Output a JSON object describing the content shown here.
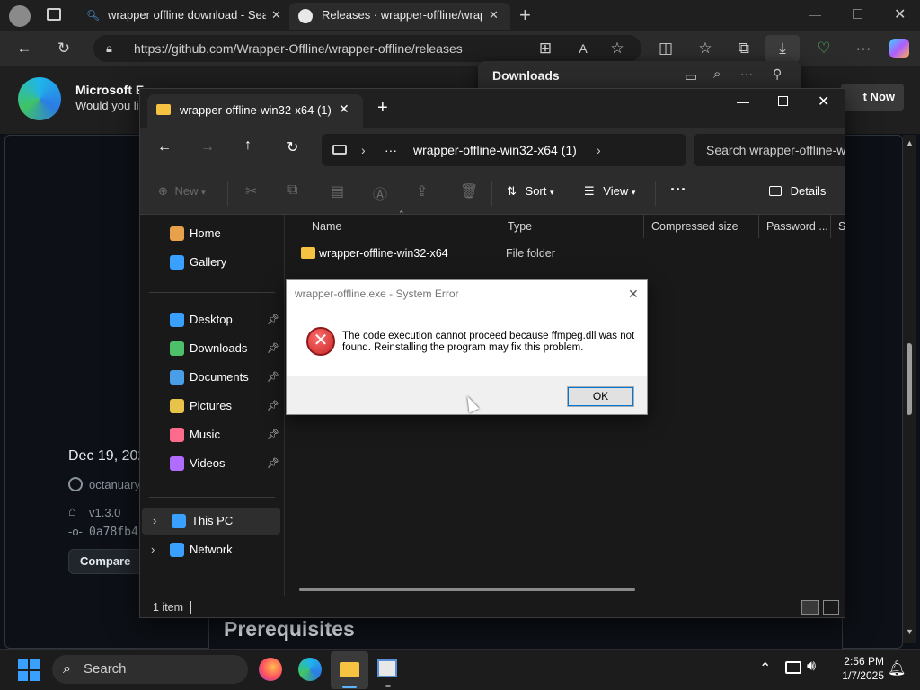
{
  "browser": {
    "tabs": [
      {
        "title": "wrapper offline download - Searc",
        "active": false
      },
      {
        "title": "Releases · wrapper-offline/wrapp",
        "active": true
      }
    ],
    "url": "https://github.com/Wrapper-Offline/wrapper-offline/releases",
    "edge_banner": {
      "title": "Microsoft E",
      "subtitle": "Would you lik",
      "cta": "t Now"
    },
    "downloads_panel": {
      "title": "Downloads"
    }
  },
  "github": {
    "date": "Dec 19, 202",
    "author": "octanuary",
    "tag": "v1.3.0",
    "commit": "0a78fb4",
    "compare_label": "Compare",
    "prereq_heading": "Prerequisites"
  },
  "explorer": {
    "tab_title": "wrapper-offline-win32-x64 (1)",
    "breadcrumb": "wrapper-offline-win32-x64 (1)",
    "breadcrumb_more": "···",
    "search_placeholder": "Search wrapper-offline-w",
    "toolbar": {
      "new": "New",
      "sort": "Sort",
      "view": "View",
      "more": "···",
      "details": "Details"
    },
    "nav": [
      {
        "label": "Home",
        "icon": "home-icon",
        "pinned": false
      },
      {
        "label": "Gallery",
        "icon": "gallery-icon",
        "pinned": false
      },
      {
        "label": "Desktop",
        "icon": "desktop-icon",
        "pinned": true
      },
      {
        "label": "Downloads",
        "icon": "download-icon",
        "pinned": true
      },
      {
        "label": "Documents",
        "icon": "documents-icon",
        "pinned": true
      },
      {
        "label": "Pictures",
        "icon": "pictures-icon",
        "pinned": true
      },
      {
        "label": "Music",
        "icon": "music-icon",
        "pinned": true
      },
      {
        "label": "Videos",
        "icon": "videos-icon",
        "pinned": true
      },
      {
        "label": "This PC",
        "icon": "pc-icon",
        "pinned": false
      },
      {
        "label": "Network",
        "icon": "network-icon",
        "pinned": false
      }
    ],
    "columns": [
      "Name",
      "Type",
      "Compressed size",
      "Password ...",
      "Si"
    ],
    "rows": [
      {
        "name": "wrapper-offline-win32-x64",
        "type": "File folder"
      }
    ],
    "status": "1 item"
  },
  "dialog": {
    "title": "wrapper-offline.exe - System Error",
    "message": "The code execution cannot proceed because ffmpeg.dll was not found. Reinstalling the program may fix this problem.",
    "ok_label": "OK"
  },
  "taskbar": {
    "search_label": "Search",
    "time": "2:56 PM",
    "date": "1/7/2025"
  },
  "colors": {
    "accent": "#0078d7",
    "error": "#d32f2f",
    "folder": "#f5c242"
  }
}
